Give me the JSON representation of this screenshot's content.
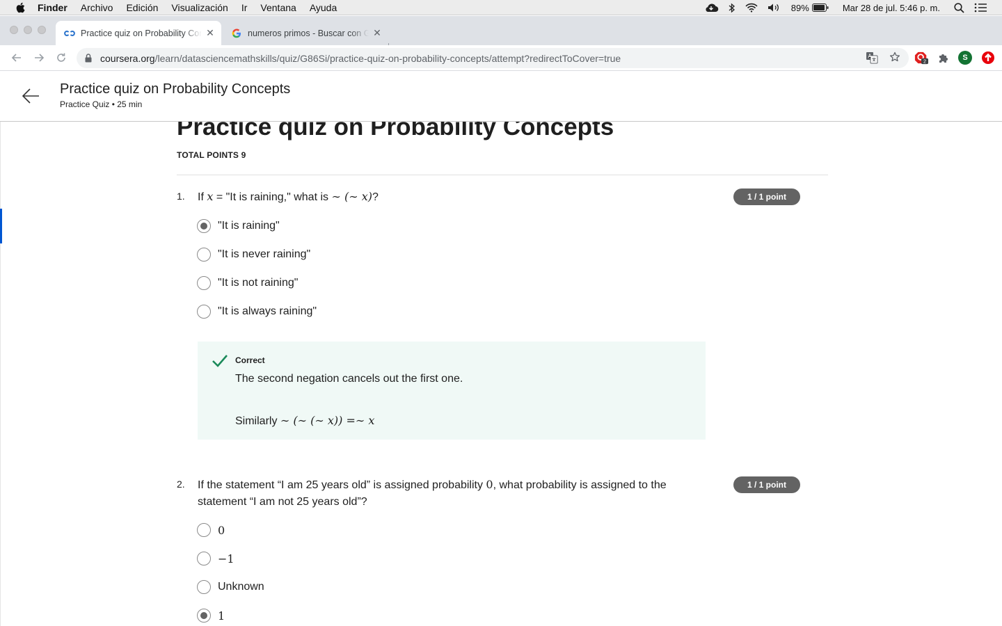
{
  "menubar": {
    "app": "Finder",
    "items": [
      "Archivo",
      "Edición",
      "Visualización",
      "Ir",
      "Ventana",
      "Ayuda"
    ],
    "battery": "89%",
    "datetime": "Mar 28 de jul.  5:46 p. m."
  },
  "browser": {
    "tabs": [
      {
        "title": "Practice quiz on Probability Concepts",
        "favicon": "coursera-icon"
      },
      {
        "title": "numeros primos - Buscar con Google",
        "favicon": "google-icon"
      }
    ],
    "url_domain": "coursera.org",
    "url_path": "/learn/datasciencemathskills/quiz/G86Si/practice-quiz-on-probability-concepts/attempt?redirectToCover=true",
    "extension_badge": "2",
    "profile_initial": "S"
  },
  "header": {
    "title": "Practice quiz on Probability Concepts",
    "subtitle": "Practice Quiz • 25 min"
  },
  "quiz": {
    "title": "Practice quiz on Probability Concepts",
    "total_points": "TOTAL POINTS 9",
    "q1": {
      "number": "1.",
      "text_a": "If ",
      "math_x": "x",
      "text_b": " = \"It is raining,\" what is ",
      "math_expr": "∼ (∼ x)",
      "text_c": "?",
      "badge": "1 / 1 point",
      "options": [
        "\"It is raining\"",
        "\"It is never raining\"",
        "\"It is not raining\"",
        "\"It is always raining\""
      ],
      "selected": 0,
      "feedback": {
        "label": "Correct",
        "text": "The second negation cancels out the first one.",
        "similarly": "Similarly ",
        "similarly_math": "∼ (∼ (∼ x)) =∼ x"
      }
    },
    "q2": {
      "number": "2.",
      "line1_a": "If the statement “I am 25 years old” is assigned probability ",
      "line1_math": "0",
      "line1_b": ", what probability is assigned to the",
      "line2": "statement “I am not 25 years old”?",
      "badge": "1 / 1 point",
      "options": [
        "0",
        "−1",
        "Unknown",
        "1"
      ],
      "selected": 3
    }
  },
  "colors": {
    "feedback_bg": "#f0f9f6",
    "check_green": "#1b8a5a",
    "badge_gray": "#636363",
    "accent_blue": "#0056d2"
  }
}
